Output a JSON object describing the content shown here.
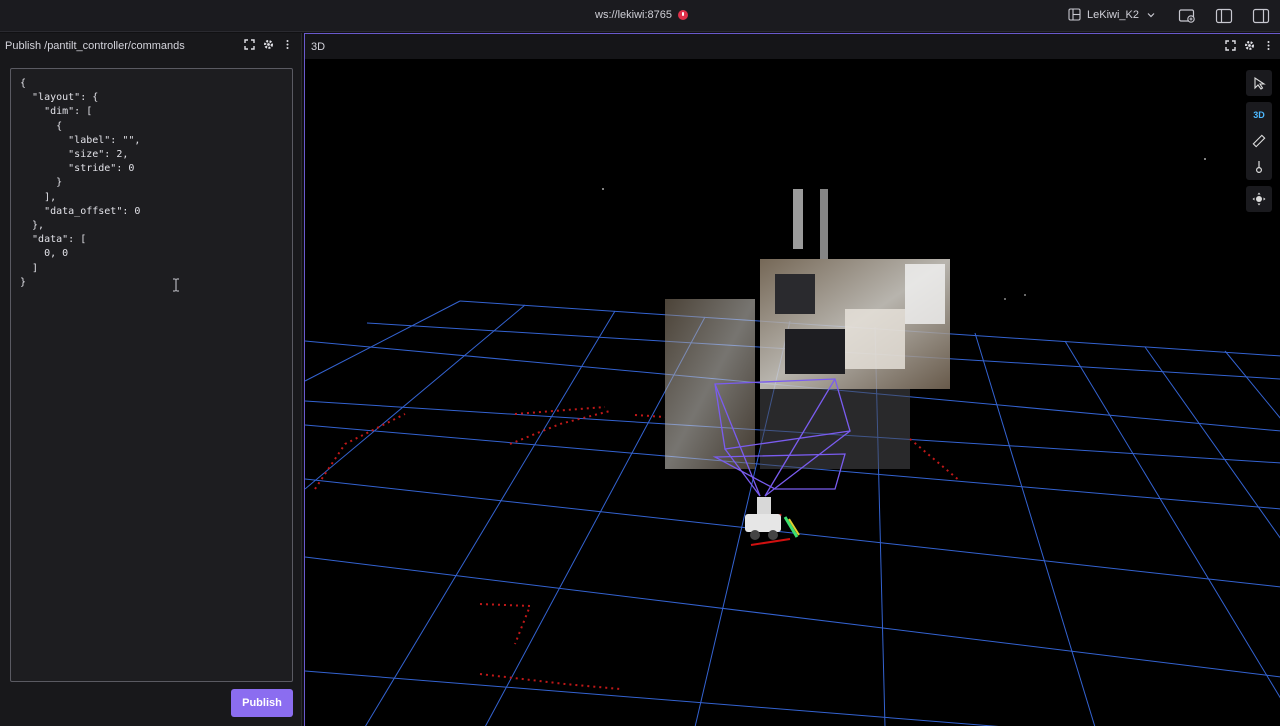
{
  "topbar": {
    "connection": "ws://lekiwi:8765",
    "layout_name": "LeKiwi_K2",
    "status_color": "#e0304a"
  },
  "left_panel": {
    "title": "Publish /pantilt_controller/commands",
    "message": "{\n  \"layout\": {\n    \"dim\": [\n      {\n        \"label\": \"\",\n        \"size\": 2,\n        \"stride\": 0\n      }\n    ],\n    \"data_offset\": 0\n  },\n  \"data\": [\n    0, 0\n  ]\n}",
    "publish_label": "Publish",
    "accent_color": "#8b6df0"
  },
  "right_panel": {
    "title": "3D",
    "view_mode_label": "3D",
    "tools": [
      "select-icon",
      "3d-view-toggle",
      "ruler-icon",
      "publish-point-icon",
      "recenter-icon"
    ],
    "grid_color": "#3a6ee8",
    "frustum_color": "#7a5cf0"
  }
}
